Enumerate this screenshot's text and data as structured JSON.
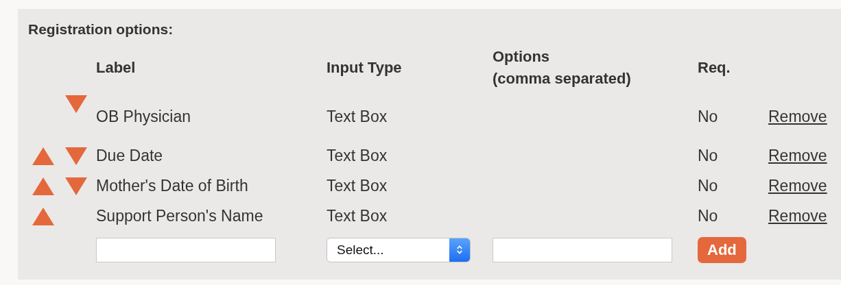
{
  "title": "Registration options:",
  "columns": [
    "Label",
    "Input Type",
    "Options\n(comma separated)",
    "Req."
  ],
  "rows": [
    {
      "can_move_up": false,
      "can_move_down": true,
      "label": "OB Physician",
      "input_type": "Text Box",
      "required": "No",
      "action": "Remove"
    },
    {
      "can_move_up": true,
      "can_move_down": true,
      "label": "Due Date",
      "input_type": "Text Box",
      "required": "No",
      "action": "Remove"
    },
    {
      "can_move_up": true,
      "can_move_down": true,
      "label": "Mother's Date of Birth",
      "input_type": "Text Box",
      "required": "No",
      "action": "Remove"
    },
    {
      "can_move_up": true,
      "can_move_down": false,
      "label": "Support Person's Name",
      "input_type": "Text Box",
      "required": "No",
      "action": "Remove"
    }
  ],
  "new_row": {
    "type_select": "Select...",
    "add_button": "Add"
  }
}
